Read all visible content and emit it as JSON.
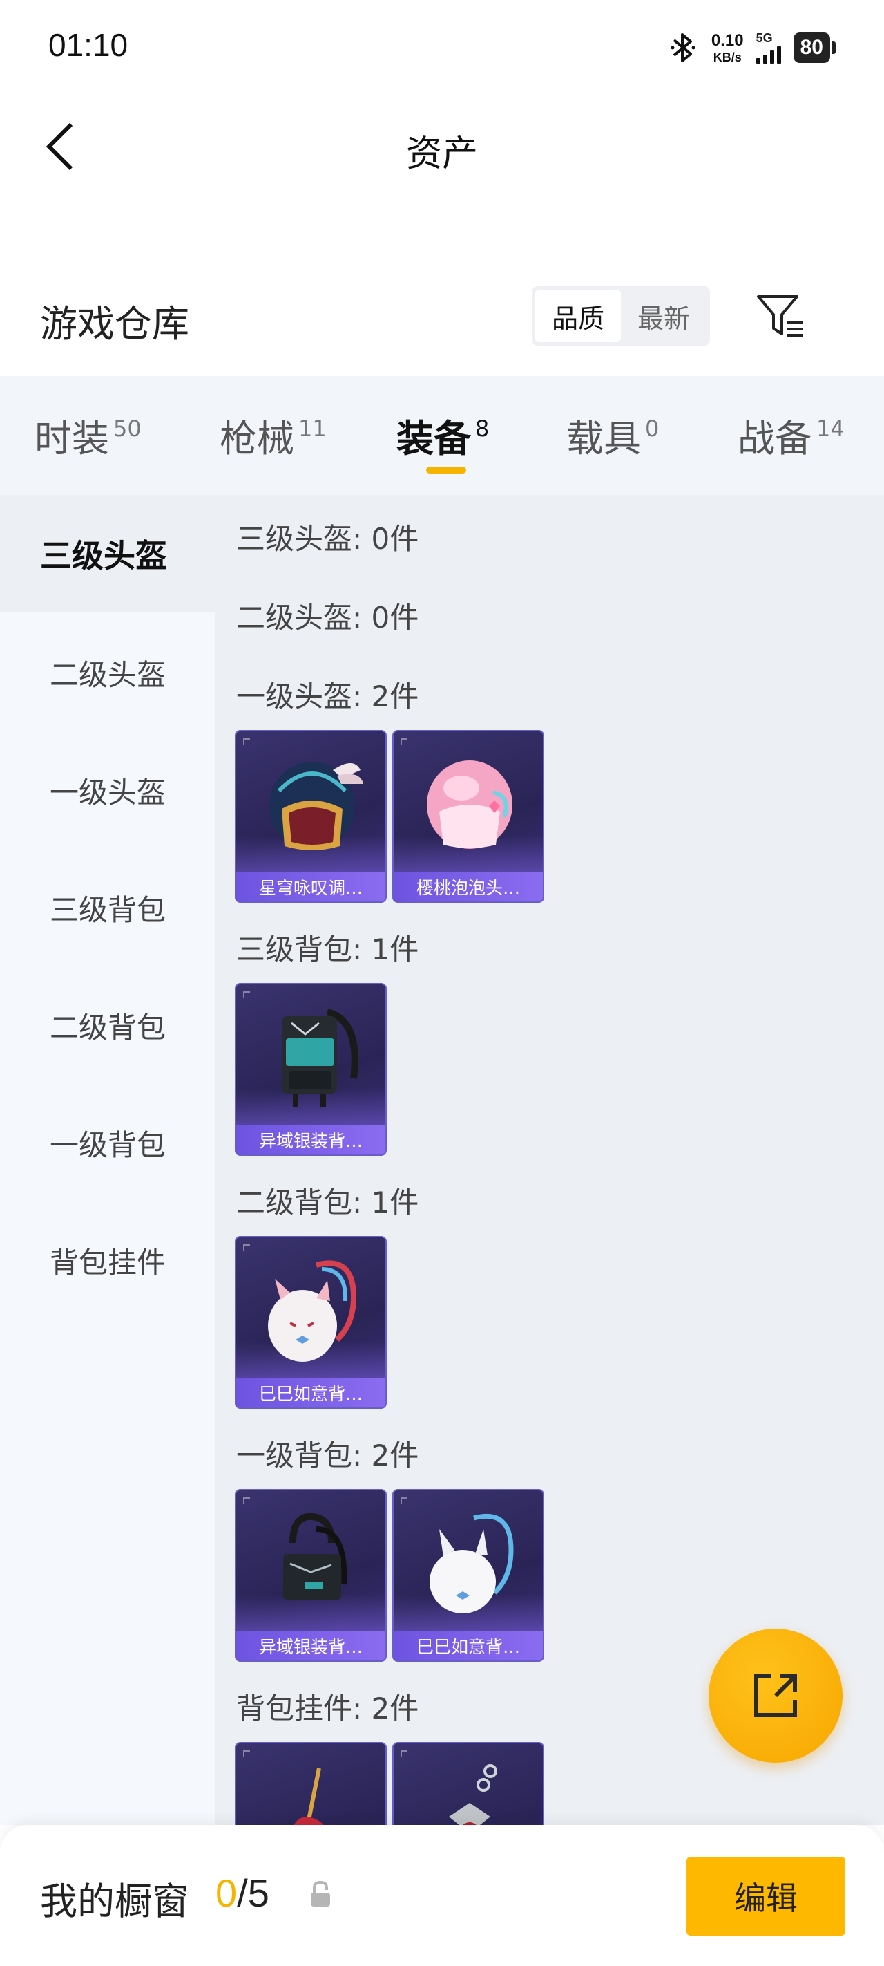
{
  "status_bar": {
    "time": "01:10",
    "speed_value": "0.10",
    "speed_unit": "KB/s",
    "network": "5G",
    "battery": "80"
  },
  "nav": {
    "title": "资产",
    "back_icon": "chevron-left-icon"
  },
  "warehouse": {
    "title": "游戏仓库",
    "sort_options": [
      "品质",
      "最新"
    ],
    "sort_selected": "品质",
    "filter_icon": "filter-icon"
  },
  "tabs": [
    {
      "label": "时装",
      "count": "50"
    },
    {
      "label": "枪械",
      "count": "11"
    },
    {
      "label": "装备",
      "count": "8",
      "active": true
    },
    {
      "label": "载具",
      "count": "0"
    },
    {
      "label": "战备",
      "count": "14"
    }
  ],
  "sidebar": {
    "items": [
      "三级头盔",
      "二级头盔",
      "一级头盔",
      "三级背包",
      "二级背包",
      "一级背包",
      "背包挂件"
    ],
    "active": "三级头盔"
  },
  "sections": [
    {
      "title": "三级头盔: 0件",
      "items": []
    },
    {
      "title": "二级头盔: 0件",
      "items": []
    },
    {
      "title": "一级头盔: 2件",
      "items": [
        {
          "name": "星穹咏叹调…",
          "icon": "helmet-dark-winged-icon"
        },
        {
          "name": "樱桃泡泡头…",
          "icon": "helmet-pink-icon"
        }
      ]
    },
    {
      "title": "三级背包: 1件",
      "items": [
        {
          "name": "异域银装背…",
          "icon": "backpack-dark-teal-icon"
        }
      ]
    },
    {
      "title": "二级背包: 1件",
      "items": [
        {
          "name": "巳巳如意背…",
          "icon": "backpack-white-bunny-icon"
        }
      ]
    },
    {
      "title": "一级背包: 2件",
      "items": [
        {
          "name": "异域银装背…",
          "icon": "backpack-dark-small-icon"
        },
        {
          "name": "巳巳如意背…",
          "icon": "backpack-white-bunny-icon"
        }
      ]
    },
    {
      "title": "背包挂件: 2件",
      "items": [
        {
          "name": "",
          "icon": "guitar-charm-icon"
        },
        {
          "name": "",
          "icon": "chain-charm-icon"
        }
      ]
    }
  ],
  "fab": {
    "icon": "share-external-icon"
  },
  "bottom_bar": {
    "label": "我的橱窗",
    "count_current": "0",
    "count_sep": "/",
    "count_total": "5",
    "lock_icon": "lock-icon",
    "edit_label": "编辑"
  },
  "colors": {
    "accent": "#f5b400",
    "card_bg": "#2a2456",
    "card_caption": "#7a5fe8"
  }
}
